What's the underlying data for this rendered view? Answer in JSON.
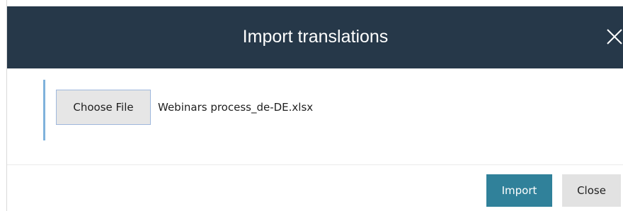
{
  "dialog": {
    "title": "Import translations",
    "close_icon": "close-icon"
  },
  "file_input": {
    "button_label": "Choose File",
    "selected_file": "Webinars process_de-DE.xlsx"
  },
  "footer": {
    "import_label": "Import",
    "close_label": "Close"
  },
  "colors": {
    "header_bg": "#263849",
    "accent_bar": "#7fb2dc",
    "import_button": "#30819a",
    "close_button": "#e2e2e2"
  }
}
